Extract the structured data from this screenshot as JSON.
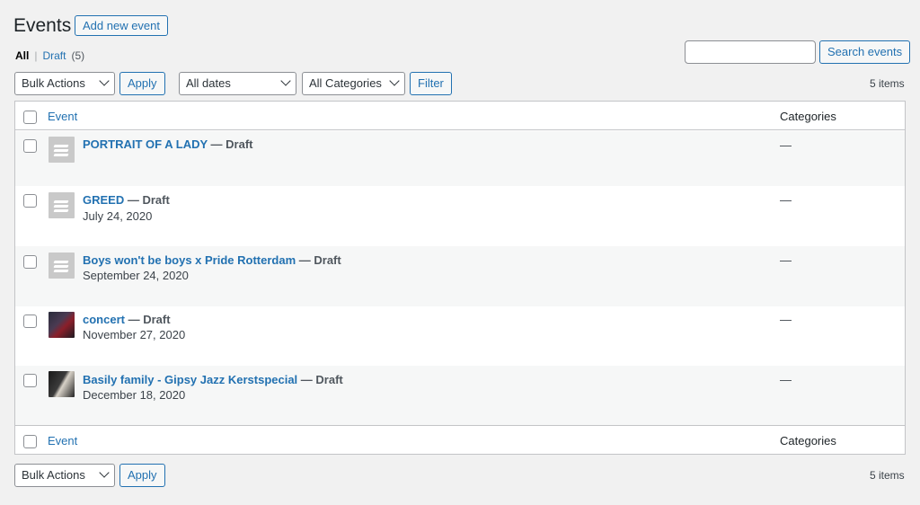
{
  "header": {
    "title": "Events",
    "add_new_label": "Add new event"
  },
  "views": {
    "all_label": "All",
    "separator": "|",
    "draft_label": "Draft",
    "draft_count": "(5)"
  },
  "search": {
    "input_value": "",
    "button_label": "Search events"
  },
  "top_nav": {
    "bulk_actions": "Bulk Actions",
    "apply_label": "Apply",
    "dates_filter": "All dates",
    "categories_filter": "All Categories",
    "filter_label": "Filter",
    "items_count": "5 items"
  },
  "table": {
    "columns": {
      "event": "Event",
      "categories": "Categories"
    },
    "rows": [
      {
        "title": "PORTRAIT OF A LADY",
        "state": "— Draft",
        "date": "",
        "categories": "—",
        "thumb": "placeholder-image-icon"
      },
      {
        "title": "GREED",
        "state": "— Draft",
        "date": "July 24, 2020",
        "categories": "—",
        "thumb": "placeholder-image-icon"
      },
      {
        "title": "Boys won't be boys x Pride Rotterdam",
        "state": "— Draft",
        "date": "September 24, 2020",
        "categories": "—",
        "thumb": "placeholder-image-icon"
      },
      {
        "title": "concert",
        "state": "— Draft",
        "date": "November 27, 2020",
        "categories": "—",
        "thumb": "photo"
      },
      {
        "title": "Basily family - Gipsy Jazz Kerstspecial",
        "state": "— Draft",
        "date": "December 18, 2020",
        "categories": "—",
        "thumb": "photo"
      }
    ]
  },
  "bottom_nav": {
    "bulk_actions": "Bulk Actions",
    "apply_label": "Apply",
    "items_count": "5 items"
  },
  "colors": {
    "accent": "#2271b1",
    "background": "#f1f1f1"
  }
}
